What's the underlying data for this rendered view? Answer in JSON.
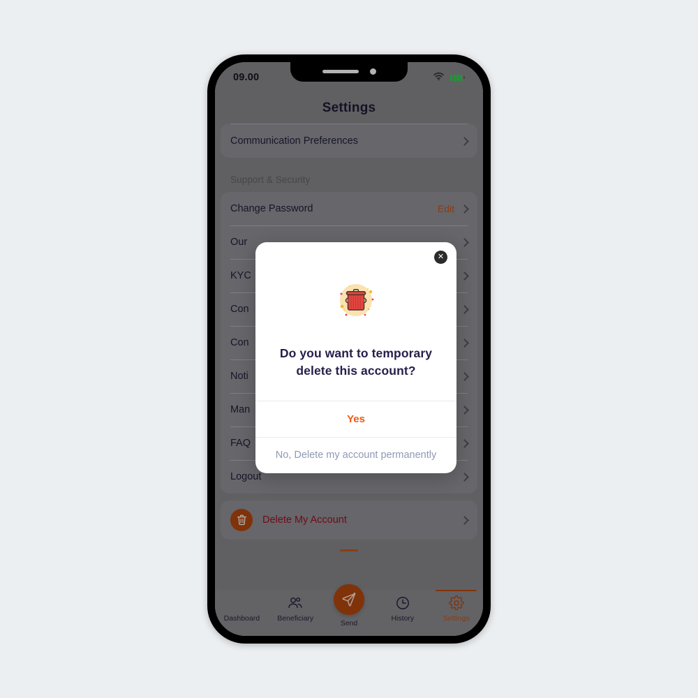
{
  "status_bar": {
    "time": "09.00",
    "wifi_icon": "wifi-icon",
    "battery_icon": "battery-icon"
  },
  "header": {
    "title": "Settings"
  },
  "settings": {
    "top_card": [
      {
        "label": "Communication Preferences",
        "action": "",
        "chevron": "chevron-right-icon"
      }
    ],
    "section_title": "Support & Security",
    "items": [
      {
        "label": "Change Password",
        "action": "Edit",
        "chevron": "chevron-right-icon"
      },
      {
        "label": "Our",
        "action": "",
        "chevron": "chevron-right-icon"
      },
      {
        "label": "KYC",
        "action": "",
        "chevron": "chevron-right-icon"
      },
      {
        "label": "Con",
        "action": "",
        "chevron": "chevron-right-icon"
      },
      {
        "label": "Con",
        "action": "",
        "chevron": "chevron-right-icon"
      },
      {
        "label": "Noti",
        "action": "",
        "chevron": "chevron-right-icon"
      },
      {
        "label": "Man",
        "action": "",
        "chevron": "chevron-right-icon"
      },
      {
        "label": "FAQ",
        "action": "",
        "chevron": "chevron-right-icon"
      },
      {
        "label": "Logout",
        "action": "",
        "chevron": "chevron-right-icon"
      }
    ],
    "delete_row": {
      "label": "Delete My Account",
      "icon": "trash-icon",
      "chevron": "chevron-right-icon"
    }
  },
  "modal": {
    "close_label": "✕",
    "illustration": "trash-can-illustration",
    "message": "Do you want to temporary delete this account?",
    "confirm_label": "Yes",
    "deny_label": "No, Delete my account permanently"
  },
  "tab_bar": {
    "items": [
      {
        "label": "Dashboard",
        "icon": "grid-icon",
        "active": false
      },
      {
        "label": "Beneficiary",
        "icon": "people-icon",
        "active": false
      },
      {
        "label": "Send",
        "icon": "send-paper-plane-icon",
        "active": false
      },
      {
        "label": "History",
        "icon": "clock-icon",
        "active": false
      },
      {
        "label": "Settings",
        "icon": "gear-icon",
        "active": true
      }
    ]
  },
  "colors": {
    "accent_orange": "#b8480e",
    "confirm_orange": "#f05a14",
    "danger_red": "#9e1420",
    "deny_blue_gray": "#8e99b5",
    "title_navy": "#25204a",
    "page_bg": "#eceff1"
  }
}
